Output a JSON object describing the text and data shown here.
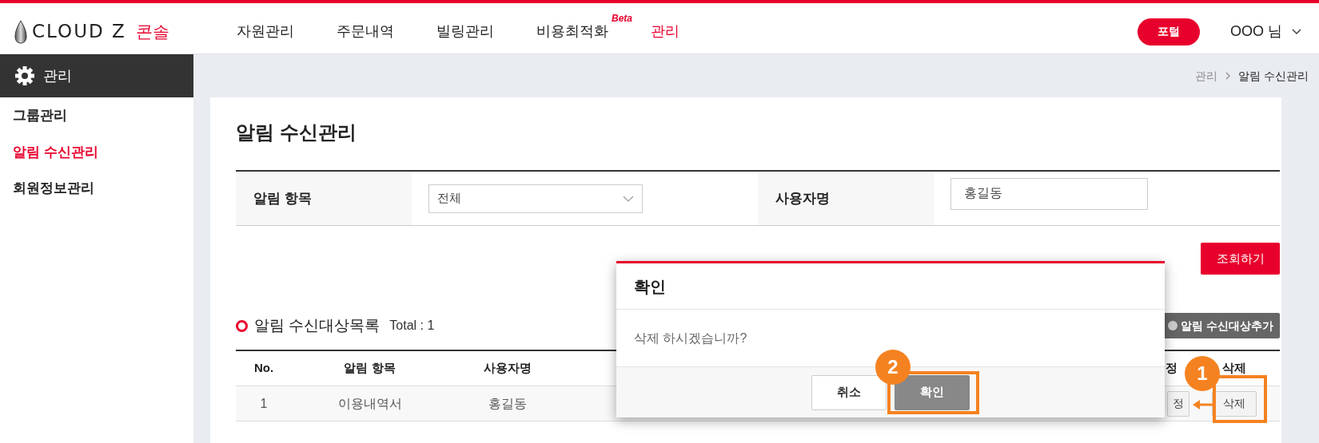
{
  "header": {
    "logo_text": "CLOUD Z",
    "logo_sub": "콘솔",
    "nav": [
      {
        "label": "자원관리",
        "selected": false
      },
      {
        "label": "주문내역",
        "selected": false
      },
      {
        "label": "빌링관리",
        "selected": false
      },
      {
        "label": "비용최적화",
        "selected": false,
        "badge": "Beta"
      },
      {
        "label": "관리",
        "selected": true
      }
    ],
    "portal_button": "포털",
    "user": "OOO 님"
  },
  "sidebar": {
    "title": "관리",
    "items": [
      {
        "label": "그룹관리",
        "selected": false
      },
      {
        "label": "알림 수신관리",
        "selected": true
      },
      {
        "label": "회원정보관리",
        "selected": false
      }
    ]
  },
  "breadcrumb": [
    "관리",
    "알림 수신관리"
  ],
  "page_title": "알림 수신관리",
  "filter": {
    "fields": [
      {
        "label": "알림 항목",
        "kind": "select",
        "value": "전체"
      },
      {
        "label": "사용자명",
        "kind": "input",
        "value": "홍길동"
      }
    ],
    "search_button": "조회하기"
  },
  "list": {
    "title": "알림 수신대상목록",
    "total": "Total : 1",
    "add_button": "알림 수신대상추가",
    "columns": [
      "No.",
      "알림 항목",
      "사용자명",
      "정",
      "삭제"
    ],
    "rows": [
      {
        "cells": [
          "1",
          "이용내역서",
          "홍길동"
        ],
        "edit_button": "정",
        "delete_button": "삭제"
      }
    ]
  },
  "dialog": {
    "title": "확인",
    "message": "삭제 하시겠습니까?",
    "buttons": [
      {
        "label": "취소",
        "kind": "secondary"
      },
      {
        "label": "확인",
        "kind": "primary"
      }
    ]
  },
  "annotations": [
    "1",
    "2"
  ]
}
